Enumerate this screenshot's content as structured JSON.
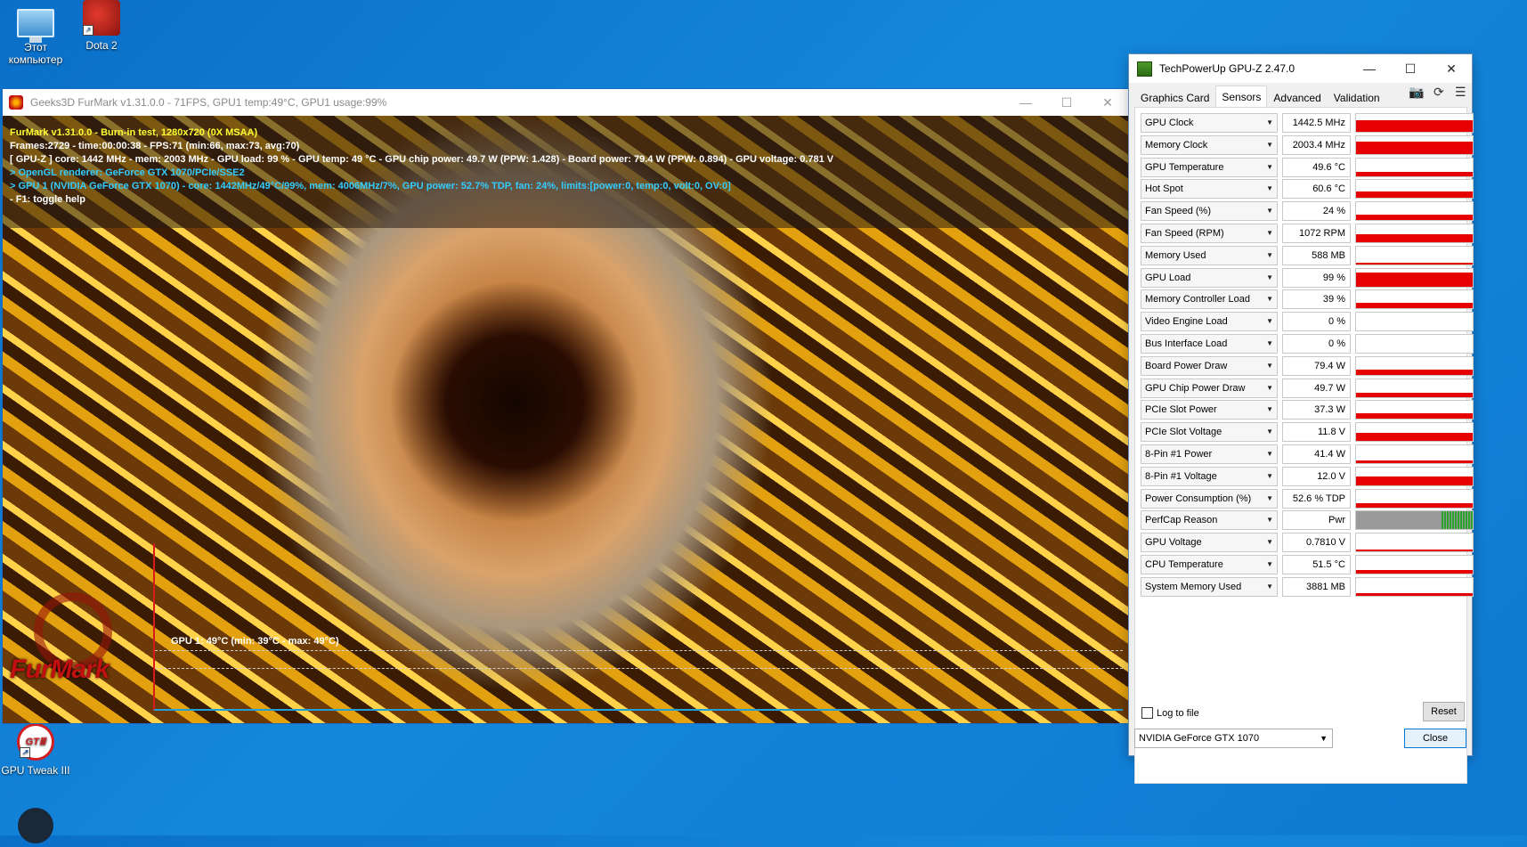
{
  "desktop": {
    "icons": [
      {
        "label": "Этот\nкомпьютер",
        "icon": "computer-icon"
      },
      {
        "label": "Dota 2",
        "icon": "dota2-icon"
      },
      {
        "label": "GPU Tweak III",
        "icon": "gpu-tweak-icon",
        "glyph": "GTⅢ"
      },
      {
        "label": "",
        "icon": "steam-icon"
      }
    ]
  },
  "furmark": {
    "title": "Geeks3D FurMark v1.31.0.0 - 71FPS, GPU1 temp:49°C, GPU1 usage:99%",
    "lines": [
      {
        "text": "FurMark v1.31.0.0 - Burn-in test, 1280x720 (0X MSAA)",
        "color": "#ffff33"
      },
      {
        "text": "Frames:2729 - time:00:00:38 - FPS:71 (min:66, max:73, avg:70)",
        "color": "#ffffff"
      },
      {
        "text": "[ GPU-Z ] core: 1442 MHz - mem: 2003 MHz - GPU load: 99 % - GPU temp: 49 °C - GPU chip power: 49.7 W (PPW: 1.428) - Board power: 79.4 W (PPW: 0.894) - GPU voltage: 0.781 V",
        "color": "#ffffff"
      },
      {
        "text": "> OpenGL renderer: GeForce GTX 1070/PCIe/SSE2",
        "color": "#33ccff"
      },
      {
        "text": "> GPU 1 (NVIDIA GeForce GTX 1070) - core: 1442MHz/49°C/99%, mem: 4006MHz/7%, GPU power: 52.7% TDP, fan: 24%, limits:[power:0, temp:0, volt:0, OV:0]",
        "color": "#33ccff"
      },
      {
        "text": "- F1: toggle help",
        "color": "#ffffff"
      }
    ],
    "graph_label": "GPU 1: 49°C (min: 39°C - max: 49°C)",
    "logo": "FurMark"
  },
  "gpuz": {
    "title": "TechPowerUp GPU-Z 2.47.0",
    "tabs": [
      "Graphics Card",
      "Sensors",
      "Advanced",
      "Validation"
    ],
    "active_tab": "Sensors",
    "sensors": [
      {
        "name": "GPU Clock",
        "value": "1442.5 MHz",
        "level": 0.65
      },
      {
        "name": "Memory Clock",
        "value": "2003.4 MHz",
        "level": 0.7
      },
      {
        "name": "GPU Temperature",
        "value": "49.6 °C",
        "level": 0.25
      },
      {
        "name": "Hot Spot",
        "value": "60.6 °C",
        "level": 0.35
      },
      {
        "name": "Fan Speed (%)",
        "value": "24 %",
        "level": 0.3
      },
      {
        "name": "Fan Speed (RPM)",
        "value": "1072 RPM",
        "level": 0.45
      },
      {
        "name": "Memory Used",
        "value": "588 MB",
        "level": 0.1
      },
      {
        "name": "GPU Load",
        "value": "99 %",
        "level": 0.8
      },
      {
        "name": "Memory Controller Load",
        "value": "39 %",
        "level": 0.3
      },
      {
        "name": "Video Engine Load",
        "value": "0 %",
        "level": 0
      },
      {
        "name": "Bus Interface Load",
        "value": "0 %",
        "level": 0
      },
      {
        "name": "Board Power Draw",
        "value": "79.4 W",
        "level": 0.3
      },
      {
        "name": "GPU Chip Power Draw",
        "value": "49.7 W",
        "level": 0.25
      },
      {
        "name": "PCIe Slot Power",
        "value": "37.3 W",
        "level": 0.3
      },
      {
        "name": "PCIe Slot Voltage",
        "value": "11.8 V",
        "level": 0.45
      },
      {
        "name": "8-Pin #1 Power",
        "value": "41.4 W",
        "level": 0.15
      },
      {
        "name": "8-Pin #1 Voltage",
        "value": "12.0 V",
        "level": 0.5
      },
      {
        "name": "Power Consumption (%)",
        "value": "52.6 % TDP",
        "level": 0.25
      },
      {
        "name": "PerfCap Reason",
        "value": "Pwr",
        "level": 1
      },
      {
        "name": "GPU Voltage",
        "value": "0.7810 V",
        "level": 0.1
      },
      {
        "name": "CPU Temperature",
        "value": "51.5 °C",
        "level": 0.2
      },
      {
        "name": "System Memory Used",
        "value": "3881 MB",
        "level": 0.15
      }
    ],
    "log_to_file": "Log to file",
    "reset": "Reset",
    "gpu_select": "NVIDIA GeForce GTX 1070",
    "close": "Close"
  }
}
